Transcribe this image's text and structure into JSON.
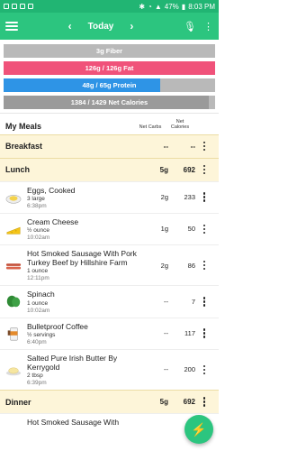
{
  "status": {
    "pct": "47%",
    "time": "8:03 PM"
  },
  "appbar": {
    "date": "Today",
    "prev_icon": "chevron-left-icon",
    "next_icon": "chevron-right-icon"
  },
  "colors": {
    "green": "#2cc57f",
    "fat": "#f0527a",
    "protein": "#2e94e6",
    "bar_bg": "#b9b9b9"
  },
  "macros": [
    {
      "label": "3g Fiber",
      "fill": 0,
      "color": "#b9b9b9"
    },
    {
      "label": "126g / 126g Fat",
      "fill": 1.0,
      "color": "#f0527a"
    },
    {
      "label": "48g / 65g Protein",
      "fill": 0.74,
      "color": "#2e94e6"
    },
    {
      "label": "1384 / 1429 Net Calories",
      "fill": 0.97,
      "color": "#9a9a9a"
    }
  ],
  "meals": {
    "title": "My Meals",
    "col_carbs": "Net Carbs",
    "col_cals_1": "Net",
    "col_cals_2": "Calories"
  },
  "breakfast": {
    "name": "Breakfast",
    "carbs": "--",
    "cals": "--"
  },
  "lunch": {
    "name": "Lunch",
    "carbs": "5g",
    "cals": "692"
  },
  "dinner": {
    "name": "Dinner",
    "carbs": "5g",
    "cals": "692"
  },
  "items": [
    {
      "name": "Eggs, Cooked",
      "qty": "3 large",
      "time": "6:38pm",
      "carbs": "2g",
      "cals": "233"
    },
    {
      "name": "Cream Cheese",
      "qty": "½ ounce",
      "time": "10:02am",
      "carbs": "1g",
      "cals": "50"
    },
    {
      "name": "Hot Smoked Sausage With Pork Turkey Beef by Hillshire Farm",
      "qty": "1 ounce",
      "time": "12:11pm",
      "carbs": "2g",
      "cals": "86"
    },
    {
      "name": "Spinach",
      "qty": "1 ounce",
      "time": "10:02am",
      "carbs": "--",
      "cals": "7"
    },
    {
      "name": "Bulletproof Coffee",
      "qty": "½ servings",
      "time": "6:40pm",
      "carbs": "--",
      "cals": "117"
    },
    {
      "name": "Salted Pure Irish Butter By Kerrygold",
      "qty": "2 tbsp",
      "time": "6:39pm",
      "carbs": "--",
      "cals": "200"
    }
  ],
  "dinner_item": {
    "name": "Hot Smoked Sausage With"
  }
}
